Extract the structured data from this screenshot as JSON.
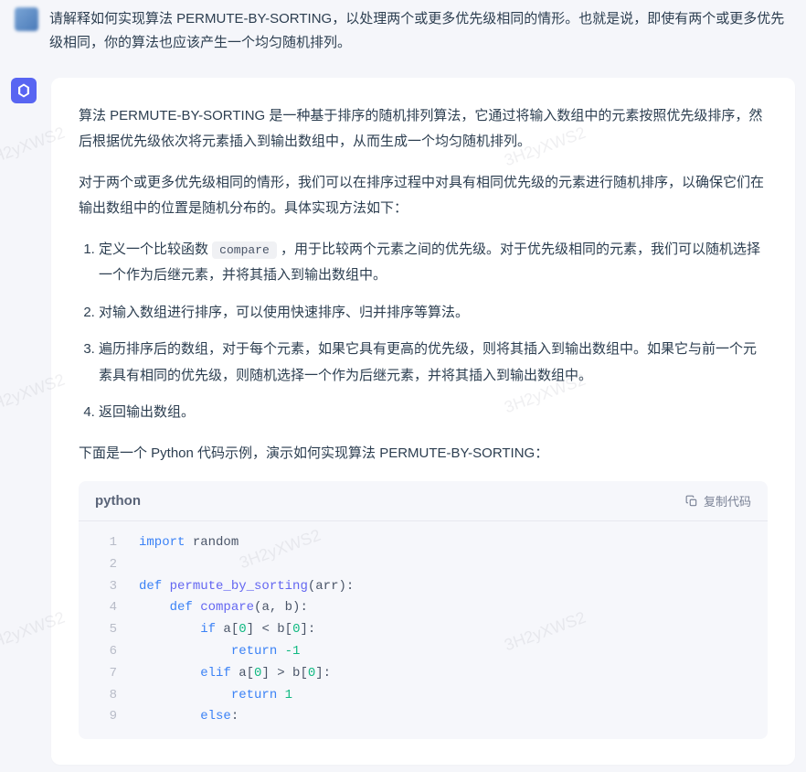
{
  "watermark": "3H2yXWS2",
  "user": {
    "message": "请解释如何实现算法 PERMUTE-BY-SORTING，以处理两个或更多优先级相同的情形。也就是说，即使有两个或更多优先级相同，你的算法也应该产生一个均匀随机排列。"
  },
  "assistant": {
    "para1": "算法 PERMUTE-BY-SORTING 是一种基于排序的随机排列算法，它通过将输入数组中的元素按照优先级排序，然后根据优先级依次将元素插入到输出数组中，从而生成一个均匀随机排列。",
    "para2": "对于两个或更多优先级相同的情形，我们可以在排序过程中对具有相同优先级的元素进行随机排序，以确保它们在输出数组中的位置是随机分布的。具体实现方法如下：",
    "ol": {
      "item1a": "定义一个比较函数 ",
      "item1code": "compare",
      "item1b": " ，用于比较两个元素之间的优先级。对于优先级相同的元素，我们可以随机选择一个作为后继元素，并将其插入到输出数组中。",
      "item2": "对输入数组进行排序，可以使用快速排序、归并排序等算法。",
      "item3": "遍历排序后的数组，对于每个元素，如果它具有更高的优先级，则将其插入到输出数组中。如果它与前一个元素具有相同的优先级，则随机选择一个作为后继元素，并将其插入到输出数组中。",
      "item4": "返回输出数组。"
    },
    "para3": "下面是一个 Python 代码示例，演示如何实现算法 PERMUTE-BY-SORTING：",
    "code": {
      "lang": "python",
      "copy_label": "复制代码",
      "lines": {
        "n1": "1",
        "n2": "2",
        "n3": "3",
        "n4": "4",
        "n5": "5",
        "n6": "6",
        "n7": "7",
        "n8": "8",
        "n9": "9",
        "l1_kw": "import",
        "l1_mod": " random",
        "l3_kw": "def",
        "l3_fn": " permute_by_sorting",
        "l3_rest": "(arr):",
        "l4_kw": "def",
        "l4_fn": " compare",
        "l4_rest": "(a, b):",
        "l5_kw": "if",
        "l5_a": " a[",
        "l5_n0a": "0",
        "l5_mid": "] < b[",
        "l5_n0b": "0",
        "l5_end": "]:",
        "l6_kw": "return",
        "l6_sp": " ",
        "l6_val": "-1",
        "l7_kw": "elif",
        "l7_a": " a[",
        "l7_n0a": "0",
        "l7_mid": "] > b[",
        "l7_n0b": "0",
        "l7_end": "]:",
        "l8_kw": "return",
        "l8_sp": " ",
        "l8_val": "1",
        "l9_kw": "else",
        "l9_end": ":"
      }
    }
  }
}
